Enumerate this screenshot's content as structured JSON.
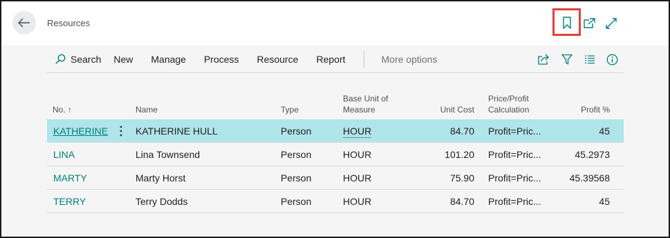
{
  "header": {
    "title": "Resources",
    "icons": [
      "back-arrow-icon",
      "bookmark-icon",
      "open-in-new-window-icon",
      "expand-icon"
    ]
  },
  "actions": {
    "search": "Search",
    "new": "New",
    "manage": "Manage",
    "process": "Process",
    "resource": "Resource",
    "report": "Report",
    "more": "More options",
    "right_icons": [
      "share-icon",
      "filter-icon",
      "list-view-icon",
      "info-icon"
    ]
  },
  "table": {
    "columns": {
      "no": "No. ↑",
      "name": "Name",
      "type": "Type",
      "base_unit_1": "Base Unit of",
      "base_unit_2": "Measure",
      "unit_cost": "Unit Cost",
      "price_1": "Price/Profit",
      "price_2": "Calculation",
      "profit": "Profit %"
    },
    "rows": [
      {
        "no": "KATHERINE",
        "name": "KATHERINE HULL",
        "type": "Person",
        "unit": "HOUR",
        "cost": "84.70",
        "calc": "Profit=Pric...",
        "profit": "45"
      },
      {
        "no": "LINA",
        "name": "Lina Townsend",
        "type": "Person",
        "unit": "HOUR",
        "cost": "101.20",
        "calc": "Profit=Pric...",
        "profit": "45.2973"
      },
      {
        "no": "MARTY",
        "name": "Marty Horst",
        "type": "Person",
        "unit": "HOUR",
        "cost": "75.90",
        "calc": "Profit=Pric...",
        "profit": "45.39568"
      },
      {
        "no": "TERRY",
        "name": "Terry Dodds",
        "type": "Person",
        "unit": "HOUR",
        "cost": "84.70",
        "calc": "Profit=Pric...",
        "profit": "45"
      }
    ]
  },
  "colors": {
    "accent": "#00807d",
    "selected_row": "#b0e5e9",
    "highlight_box": "#e2413a"
  }
}
